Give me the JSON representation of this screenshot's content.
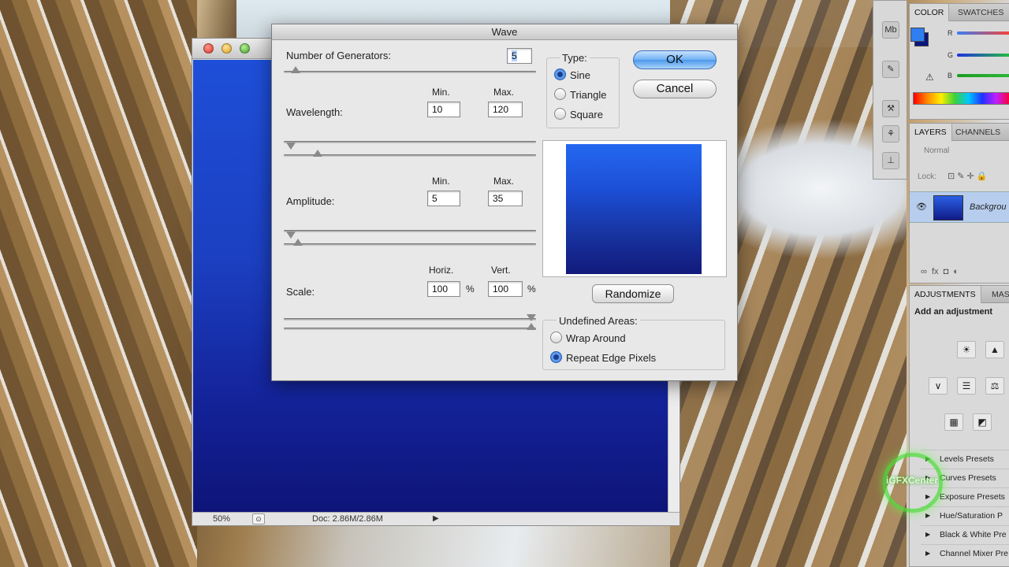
{
  "document": {
    "zoom": "50%",
    "doc_size": "Doc: 2.86M/2.86M",
    "arrow": "▶",
    "nav_icon": "⊙"
  },
  "dialog": {
    "title": "Wave",
    "generators_label": "Number of Generators:",
    "generators_value": "5",
    "generators_level": 0.03,
    "min_label": "Min.",
    "max_label": "Max.",
    "wavelength_label": "Wavelength:",
    "wavelength_min": "10",
    "wavelength_max": "120",
    "wavelength_min_level": 0.01,
    "wavelength_max_level": 0.12,
    "amplitude_label": "Amplitude:",
    "amplitude_min": "5",
    "amplitude_max": "35",
    "amplitude_min_level": 0.01,
    "amplitude_max_level": 0.04,
    "scale_label": "Scale:",
    "horiz_label": "Horiz.",
    "vert_label": "Vert.",
    "horiz_value": "100",
    "vert_value": "100",
    "percent": "%",
    "horiz_level": 1.0,
    "vert_level": 1.0,
    "type_group": "Type:",
    "type_options": [
      "Sine",
      "Triangle",
      "Square"
    ],
    "type_selected": "Sine",
    "ok_label": "OK",
    "cancel_label": "Cancel",
    "randomize_label": "Randomize",
    "undefined_group": "Undefined Areas:",
    "undefined_options": [
      "Wrap Around",
      "Repeat Edge Pixels"
    ],
    "undefined_selected": "Repeat Edge Pixels"
  },
  "panels": {
    "color_tabs": [
      "COLOR",
      "SWATCHES"
    ],
    "channels": [
      "R",
      "G",
      "B"
    ],
    "foreground_color": "#2f7ef2",
    "background_color": "#0a1580",
    "layers_tabs": [
      "LAYERS",
      "CHANNELS"
    ],
    "blend_mode": "Normal",
    "lock_label": "Lock:",
    "layer_name": "Backgrou",
    "adjustments_tabs": [
      "ADJUSTMENTS",
      "MAS"
    ],
    "adjustments_hint": "Add an adjustment",
    "adjustment_presets": [
      "Levels Presets",
      "Curves Presets",
      "Exposure Presets",
      "Hue/Saturation P",
      "Black & White Pre",
      "Channel Mixer Pre"
    ]
  },
  "watermark": "iGFXCenter"
}
